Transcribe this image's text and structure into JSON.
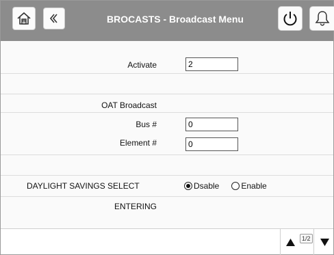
{
  "header": {
    "title": "BROCASTS - Broadcast Menu",
    "icons": [
      "home-icon",
      "back-chevron-icon",
      "power-icon",
      "bell-icon"
    ],
    "background": "#8c8c8c"
  },
  "rows": {
    "activate": {
      "label": "Activate",
      "value": "2"
    },
    "oat_broadcast": {
      "label": "OAT Broadcast"
    },
    "bus": {
      "label": "Bus #",
      "value": "0"
    },
    "element": {
      "label": "Element #",
      "value": "0"
    },
    "dst": {
      "label": "DAYLIGHT SAVINGS SELECT",
      "options": [
        "Dsable",
        "Enable"
      ],
      "selected": "Dsable"
    },
    "entering": {
      "label": "ENTERING"
    }
  },
  "footer": {
    "page": "1/2",
    "icons": [
      "arrow-up-icon",
      "arrow-down-icon"
    ]
  }
}
